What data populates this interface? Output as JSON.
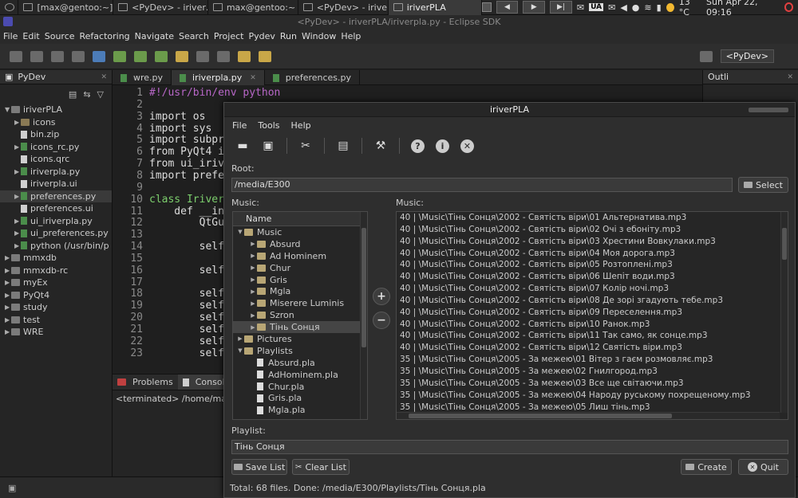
{
  "taskbar": {
    "tasks": [
      "[max@gentoo:~]",
      "<PyDev> - iriver…",
      "max@gentoo:~",
      "<PyDev> - iriverPLA…",
      "iriverPLA"
    ],
    "lang": "UA",
    "weather": "13 °C",
    "clock": "Sun Apr 22, 09:16"
  },
  "eclipse": {
    "title": "<PyDev> - iriverPLA/iriverpla.py - Eclipse SDK",
    "menu": [
      "File",
      "Edit",
      "Source",
      "Refactoring",
      "Navigate",
      "Search",
      "Project",
      "Pydev",
      "Run",
      "Window",
      "Help"
    ],
    "perspective": "<PyDev>",
    "explorer_title": "PyDev",
    "explorer_items": [
      {
        "label": "iriverPLA",
        "icon": "project-icon",
        "arrow": "▼"
      },
      {
        "label": "icons",
        "icon": "folder-icon",
        "arrow": "▶"
      },
      {
        "label": "bin.zip",
        "icon": "file-icon",
        "arrow": ""
      },
      {
        "label": "icons_rc.py",
        "icon": "python-file-icon",
        "arrow": "▶"
      },
      {
        "label": "icons.qrc",
        "icon": "file-icon",
        "arrow": ""
      },
      {
        "label": "iriverpla.py",
        "icon": "python-file-icon",
        "arrow": "▶"
      },
      {
        "label": "iriverpla.ui",
        "icon": "file-icon",
        "arrow": ""
      },
      {
        "label": "preferences.py",
        "icon": "python-file-icon",
        "arrow": "▶"
      },
      {
        "label": "preferences.ui",
        "icon": "file-icon",
        "arrow": ""
      },
      {
        "label": "ui_iriverpla.py",
        "icon": "python-file-icon",
        "arrow": "▶"
      },
      {
        "label": "ui_preferences.py",
        "icon": "python-file-icon",
        "arrow": "▶"
      },
      {
        "label": "python  (/usr/bin/p",
        "icon": "python-file-icon",
        "arrow": "▶"
      },
      {
        "label": "mmxdb",
        "icon": "project-icon",
        "arrow": "▶"
      },
      {
        "label": "mmxdb-rc",
        "icon": "project-icon",
        "arrow": "▶"
      },
      {
        "label": "myEx",
        "icon": "project-icon",
        "arrow": "▶"
      },
      {
        "label": "PyQt4",
        "icon": "project-icon",
        "arrow": "▶"
      },
      {
        "label": "study",
        "icon": "project-icon",
        "arrow": "▶"
      },
      {
        "label": "test",
        "icon": "project-icon",
        "arrow": "▶"
      },
      {
        "label": "WRE",
        "icon": "project-icon",
        "arrow": "▶"
      }
    ],
    "editor_tabs": [
      "wre.py",
      "iriverpla.py",
      "preferences.py"
    ],
    "outline_title": "Outli",
    "code": [
      {
        "n": "1",
        "t": "#!/usr/bin/env python",
        "c": "cm"
      },
      {
        "n": "2",
        "t": "",
        "c": ""
      },
      {
        "n": "3",
        "t": "import os",
        "c": ""
      },
      {
        "n": "4",
        "t": "import sys",
        "c": ""
      },
      {
        "n": "5",
        "t": "import subpr",
        "c": ""
      },
      {
        "n": "6",
        "t": "from PyQt4 i",
        "c": ""
      },
      {
        "n": "7",
        "t": "from ui_iriv",
        "c": ""
      },
      {
        "n": "8",
        "t": "import prefe",
        "c": ""
      },
      {
        "n": "9",
        "t": "",
        "c": ""
      },
      {
        "n": "10",
        "t": "class Iriver",
        "c": "cls"
      },
      {
        "n": "11",
        "t": "    def __in",
        "c": ""
      },
      {
        "n": "12",
        "t": "        QtGu",
        "c": ""
      },
      {
        "n": "13",
        "t": "",
        "c": ""
      },
      {
        "n": "14",
        "t": "        self",
        "c": ""
      },
      {
        "n": "15",
        "t": "",
        "c": ""
      },
      {
        "n": "16",
        "t": "        self",
        "c": ""
      },
      {
        "n": "17",
        "t": "",
        "c": ""
      },
      {
        "n": "18",
        "t": "        self",
        "c": ""
      },
      {
        "n": "19",
        "t": "        self",
        "c": ""
      },
      {
        "n": "20",
        "t": "        self",
        "c": ""
      },
      {
        "n": "21",
        "t": "        self",
        "c": ""
      },
      {
        "n": "22",
        "t": "        self",
        "c": ""
      },
      {
        "n": "23",
        "t": "        self",
        "c": ""
      }
    ],
    "bottom_tabs": [
      "Problems",
      "Console"
    ],
    "console_text": "<terminated> /home/max/"
  },
  "dialog": {
    "title": "iriverPLA",
    "menu": [
      "File",
      "Tools",
      "Help"
    ],
    "root_label": "Root:",
    "root_value": "/media/E300",
    "select_button": "Select",
    "music_label_left": "Music:",
    "music_label_right": "Music:",
    "tree_header": "Name",
    "tree": [
      {
        "label": "Music",
        "depth": 0,
        "arrow": "▼",
        "kind": "folder",
        "sel": false
      },
      {
        "label": "Absurd",
        "depth": 1,
        "arrow": "▶",
        "kind": "folder",
        "sel": false
      },
      {
        "label": "Ad Hominem",
        "depth": 1,
        "arrow": "▶",
        "kind": "folder",
        "sel": false
      },
      {
        "label": "Chur",
        "depth": 1,
        "arrow": "▶",
        "kind": "folder",
        "sel": false
      },
      {
        "label": "Gris",
        "depth": 1,
        "arrow": "▶",
        "kind": "folder",
        "sel": false
      },
      {
        "label": "Mgla",
        "depth": 1,
        "arrow": "▶",
        "kind": "folder",
        "sel": false
      },
      {
        "label": "Miserere Luminis",
        "depth": 1,
        "arrow": "▶",
        "kind": "folder",
        "sel": false
      },
      {
        "label": "Szron",
        "depth": 1,
        "arrow": "▶",
        "kind": "folder",
        "sel": false
      },
      {
        "label": "Тінь Сонця",
        "depth": 1,
        "arrow": "▶",
        "kind": "folder",
        "sel": true
      },
      {
        "label": "Pictures",
        "depth": 0,
        "arrow": "▶",
        "kind": "folder",
        "sel": false
      },
      {
        "label": "Playlists",
        "depth": 0,
        "arrow": "▼",
        "kind": "folder",
        "sel": false
      },
      {
        "label": "Absurd.pla",
        "depth": 1,
        "arrow": "",
        "kind": "doc",
        "sel": false
      },
      {
        "label": "AdHominem.pla",
        "depth": 1,
        "arrow": "",
        "kind": "doc",
        "sel": false
      },
      {
        "label": "Chur.pla",
        "depth": 1,
        "arrow": "",
        "kind": "doc",
        "sel": false
      },
      {
        "label": "Gris.pla",
        "depth": 1,
        "arrow": "",
        "kind": "doc",
        "sel": false
      },
      {
        "label": "Mgla.pla",
        "depth": 1,
        "arrow": "",
        "kind": "doc",
        "sel": false
      }
    ],
    "music_files": [
      "40 | \\Music\\Тінь Сонця\\2002 - Святість віри\\01 Альтернатива.mp3",
      "40 | \\Music\\Тінь Сонця\\2002 - Святість віри\\02 Очі з eбоніту.mp3",
      "40 | \\Music\\Тінь Сонця\\2002 - Святість віри\\03 Хрестини Вовкулаки.mp3",
      "40 | \\Music\\Тінь Сонця\\2002 - Святість віри\\04 Моя дорога.mp3",
      "40 | \\Music\\Тінь Сонця\\2002 - Святість віри\\05 Розтоплені.mp3",
      "40 | \\Music\\Тінь Сонця\\2002 - Святість віри\\06 Шепіт води.mp3",
      "40 | \\Music\\Тінь Сонця\\2002 - Святість віри\\07 Колір ночі.mp3",
      "40 | \\Music\\Тінь Сонця\\2002 - Святість віри\\08 Де зорі згадують тебе.mp3",
      "40 | \\Music\\Тінь Сонця\\2002 - Святість віри\\09 Переселення.mp3",
      "40 | \\Music\\Тінь Сонця\\2002 - Святість віри\\10 Ранок.mp3",
      "40 | \\Music\\Тінь Сонця\\2002 - Святість віри\\11 Так само, як сонце.mp3",
      "40 | \\Music\\Тінь Сонця\\2002 - Святість віри\\12 Святість віри.mp3",
      "35 | \\Music\\Тінь Сонця\\2005 - За межею\\01 Вітер з гаєм розмовляє.mp3",
      "35 | \\Music\\Тінь Сонця\\2005 - За межею\\02 Гнилгород.mp3",
      "35 | \\Music\\Тінь Сонця\\2005 - За межею\\03 Все ще світаючи.mp3",
      "35 | \\Music\\Тінь Сонця\\2005 - За межею\\04 Народу руському похрещеному.mp3",
      "35 | \\Music\\Тінь Сонця\\2005 - За межею\\05 Лиш тінь.mp3"
    ],
    "playlist_label": "Playlist:",
    "playlist_value": "Тінь Сонця",
    "save_button": "Save List",
    "clear_button": "Clear List",
    "create_button": "Create",
    "quit_button": "Quit",
    "status": "Total: 68 files. Done: /media/E300/Playlists/Тінь Сонця.pla"
  }
}
